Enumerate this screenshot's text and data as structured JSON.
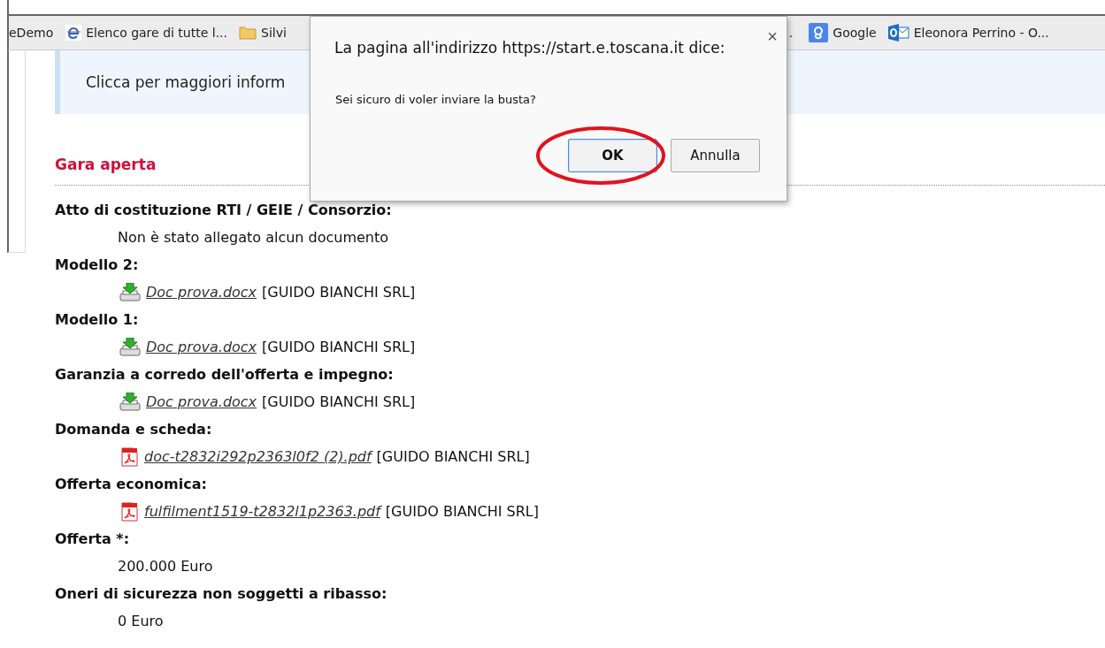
{
  "bookmarks": [
    {
      "label": "eDemo",
      "kind": "none"
    },
    {
      "label": "Elenco gare di tutte l...",
      "kind": "ie"
    },
    {
      "label": "Silvi",
      "kind": "folder"
    },
    {
      "label": ".",
      "kind": "none"
    },
    {
      "label": "Google",
      "kind": "google"
    },
    {
      "label": "Eleonora Perrino - O...",
      "kind": "outlook"
    }
  ],
  "info_box": {
    "text": "Clicca per maggiori inform"
  },
  "section_title": "Gara aperta",
  "fields": [
    {
      "label": "Atto di costituzione RTI / GEIE / Consorzio:",
      "items": [
        {
          "kind": "text",
          "text": "Non è stato allegato alcun documento"
        }
      ]
    },
    {
      "label": "Modello 2:",
      "items": [
        {
          "kind": "download",
          "file": "Doc prova.docx",
          "owner": "[GUIDO BIANCHI SRL]"
        }
      ]
    },
    {
      "label": "Modello 1:",
      "items": [
        {
          "kind": "download",
          "file": "Doc prova.docx",
          "owner": "[GUIDO BIANCHI SRL]"
        }
      ]
    },
    {
      "label": "Garanzia a corredo dell'offerta e impegno:",
      "items": [
        {
          "kind": "download",
          "file": "Doc prova.docx",
          "owner": "[GUIDO BIANCHI SRL]"
        }
      ]
    },
    {
      "label": "Domanda e scheda:",
      "items": [
        {
          "kind": "pdf",
          "file": "doc-t2832i292p2363l0f2 (2).pdf",
          "owner": "[GUIDO BIANCHI SRL]"
        }
      ]
    },
    {
      "label": "Offerta economica:",
      "items": [
        {
          "kind": "pdf",
          "file": "fulfilment1519-t2832l1p2363.pdf",
          "owner": "[GUIDO BIANCHI SRL]"
        }
      ]
    },
    {
      "label": "Offerta *:",
      "items": [
        {
          "kind": "text",
          "text": "200.000 Euro"
        }
      ]
    },
    {
      "label": "Oneri di sicurezza non soggetti a ribasso:",
      "items": [
        {
          "kind": "text",
          "text": "0 Euro"
        }
      ]
    }
  ],
  "dialog": {
    "title": "La pagina all'indirizzo https://start.e.toscana.it dice:",
    "close": "×",
    "message": "Sei sicuro di voler inviare la busta?",
    "buttons": [
      {
        "label": "OK",
        "default": true,
        "circled": true
      },
      {
        "label": "Annulla",
        "default": false,
        "circled": false
      }
    ]
  }
}
